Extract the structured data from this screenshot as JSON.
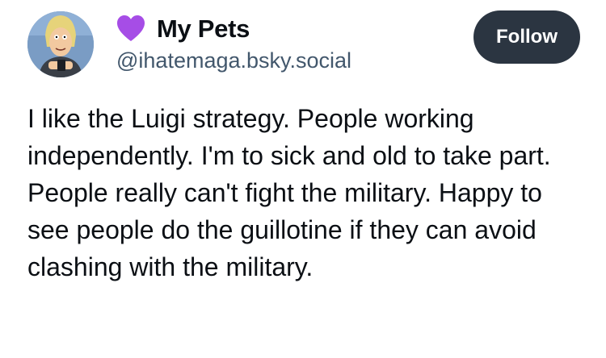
{
  "author": {
    "display_name": "My Pets",
    "handle": "@ihatemaga.bsky.social",
    "name_emoji_icon": "purple-heart-icon",
    "avatar_icon": "cartoon-character-avatar"
  },
  "actions": {
    "follow_label": "Follow"
  },
  "post": {
    "text": "I like the Luigi strategy. People working independently. I'm to sick and old to take part. People really can't fight the military. Happy to see people do the guillotine if they can avoid clashing with the military."
  },
  "colors": {
    "follow_button_bg": "#2b3541",
    "handle_text": "#42576c",
    "heart": "#a64de6",
    "body_text": "#0b0f14"
  }
}
